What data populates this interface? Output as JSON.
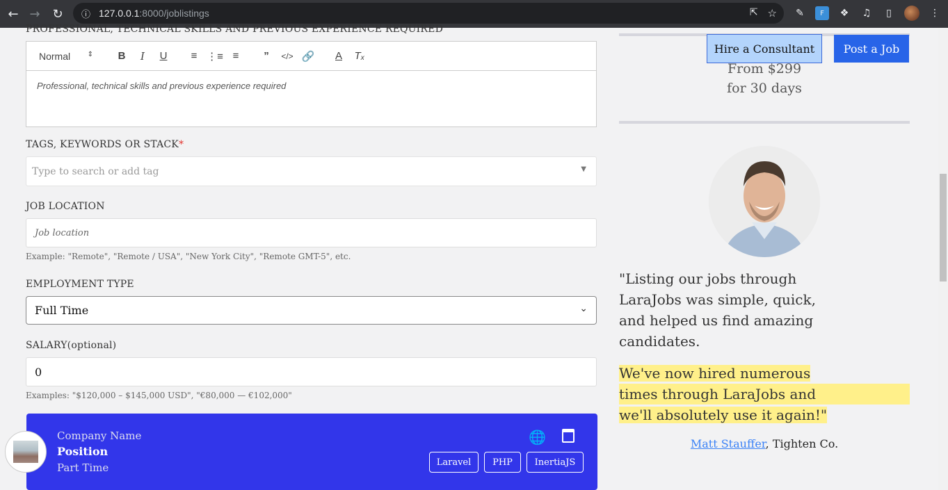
{
  "browser": {
    "url_host": "127.0.0.1",
    "url_path": ":8000/joblistings"
  },
  "form": {
    "experience": {
      "label": "PROFESSIONAL, TECHNICAL SKILLS AND PREVIOUS EXPERIENCE REQUIRED",
      "heading_select": "Normal",
      "placeholder": "Professional, technical skills and previous experience required"
    },
    "tags": {
      "label": "TAGS, KEYWORDS OR STACK",
      "required_mark": "*",
      "placeholder": "Type to search or add tag"
    },
    "location": {
      "label": "JOB LOCATION",
      "placeholder": "Job location",
      "help": "Example: \"Remote\", \"Remote / USA\", \"New York City\", \"Remote GMT-5\", etc."
    },
    "employment": {
      "label": "EMPLOYMENT TYPE",
      "value": "Full Time"
    },
    "salary": {
      "label": "SALARY(optional)",
      "value": "0",
      "help": "Examples: \"$120,000 – $145,000 USD\", \"€80,000 — €102,000\""
    }
  },
  "preview": {
    "company": "Company Name",
    "position": "Position",
    "type": "Part Time",
    "tags": [
      "Laravel",
      "PHP",
      "InertiaJS"
    ]
  },
  "sidebar": {
    "hire_button": "Hire a Consultant",
    "post_button": "Post a Job",
    "price_line1": "From $299",
    "price_line2": "for 30 days",
    "quote_lines": [
      "\"Listing our jobs through",
      "LaraJobs was simple, quick,",
      "and helped us find amazing",
      "candidates."
    ],
    "highlight_lines": [
      "We've now hired numerous",
      "times through LaraJobs and",
      "we'll absolutely use it again!\""
    ],
    "author_name": "Matt Stauffer",
    "author_company": ", Tighten Co."
  }
}
